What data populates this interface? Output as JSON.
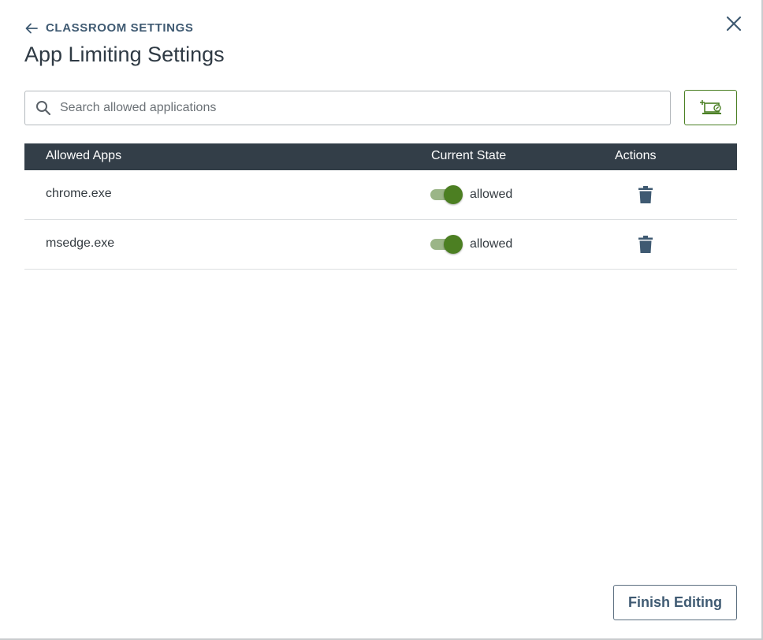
{
  "header": {
    "back_label": "CLASSROOM SETTINGS",
    "title": "App Limiting Settings"
  },
  "search": {
    "placeholder": "Search allowed applications",
    "value": ""
  },
  "table": {
    "columns": [
      "Allowed Apps",
      "Current State",
      "Actions"
    ],
    "rows": [
      {
        "app": "chrome.exe",
        "state": "allowed",
        "enabled": true
      },
      {
        "app": "msedge.exe",
        "state": "allowed",
        "enabled": true
      }
    ]
  },
  "footer": {
    "finish_label": "Finish Editing"
  },
  "icons": {
    "back": "arrow-left-icon",
    "close": "close-icon",
    "search": "search-icon",
    "add_app": "add-application-icon",
    "delete": "trash-icon"
  },
  "colors": {
    "accent_green": "#4c7f22",
    "toggle_track": "#9bb587",
    "header_bg": "#333e48",
    "link_blue": "#3f5a72"
  }
}
